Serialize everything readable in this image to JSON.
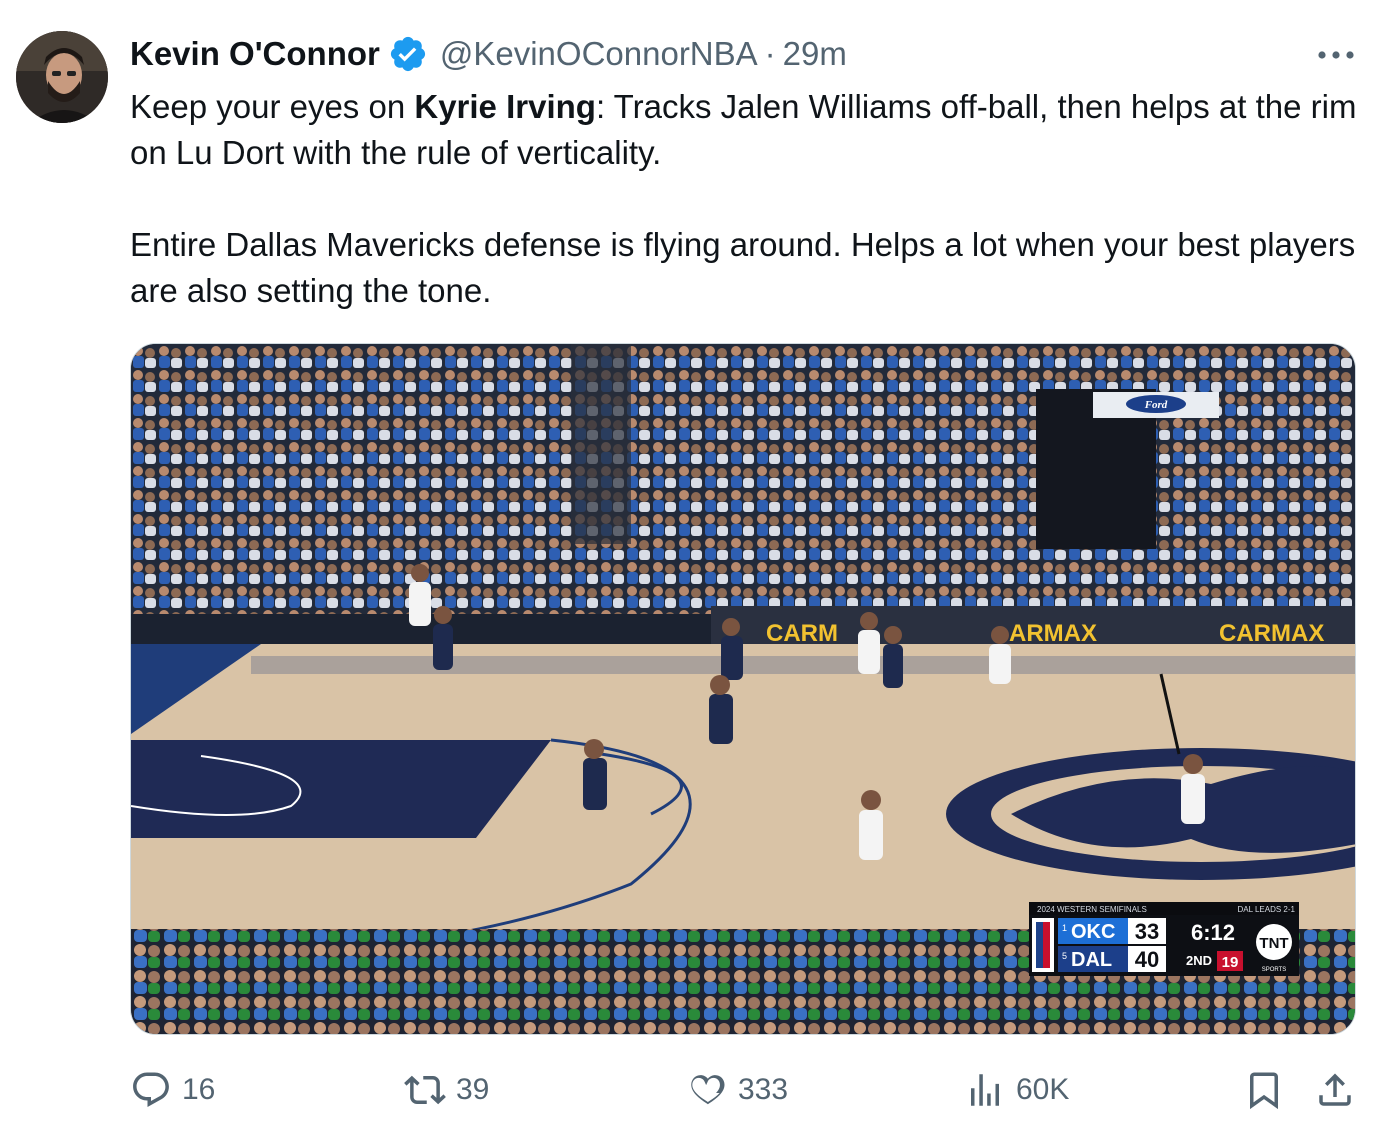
{
  "author": {
    "display_name": "Kevin O'Connor",
    "handle": "@KevinOConnorNBA",
    "separator": "·",
    "time": "29m",
    "verified": true
  },
  "tweet": {
    "para1_pre": "Keep your eyes on ",
    "para1_bold": "Kyrie Irving",
    "para1_post": ": Tracks Jalen Williams off-ball, then helps at the rim on Lu Dort with the rule of verticality.",
    "para2": "Entire Dallas Mavericks defense is flying around. Helps a lot when your best players are also setting the tone."
  },
  "media": {
    "ad_boards": [
      "CARM",
      "ARMAX",
      "CARMAX"
    ],
    "sponsor_logo": "Ford",
    "scorebug": {
      "series_title": "2024 WESTERN SEMIFINALS",
      "series_status": "DAL LEADS 2-1",
      "team1_seed": "1",
      "team1": "OKC",
      "team1_score": "33",
      "team2_seed": "5",
      "team2": "DAL",
      "team2_score": "40",
      "clock": "6:12",
      "period": "2ND",
      "shot_clock": "19",
      "network": "TNT",
      "network_sub": "SPORTS"
    }
  },
  "actions": {
    "replies": "16",
    "retweets": "39",
    "likes": "333",
    "views": "60K"
  },
  "colors": {
    "text_primary": "#0f1419",
    "text_secondary": "#536471",
    "verified": "#1d9bf0",
    "court_floor": "#d9c3a6",
    "court_navy": "#1f2a55"
  },
  "icons": [
    "verified-badge-icon",
    "more-icon",
    "reply-icon",
    "retweet-icon",
    "like-icon",
    "views-icon",
    "bookmark-icon",
    "share-icon"
  ]
}
